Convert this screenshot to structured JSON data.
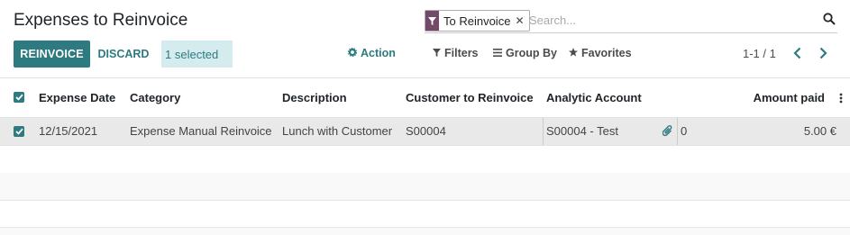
{
  "page": {
    "title": "Expenses to Reinvoice"
  },
  "search": {
    "facet_label": "To Reinvoice",
    "facet_icon": "filter-icon",
    "placeholder": "Search..."
  },
  "toolbar": {
    "reinvoice_label": "REINVOICE",
    "discard_label": "DISCARD",
    "selected_label": "1 selected",
    "action_label": "Action",
    "filters_label": "Filters",
    "groupby_label": "Group By",
    "favorites_label": "Favorites",
    "pager_label": "1-1 / 1"
  },
  "colors": {
    "primary": "#2d7b80",
    "brand": "#714b67",
    "selection": "#d5ecef"
  },
  "table": {
    "columns": {
      "expense_date": "Expense Date",
      "category": "Category",
      "description": "Description",
      "customer": "Customer to Reinvoice",
      "analytic": "Analytic Account",
      "amount": "Amount paid"
    },
    "rows": [
      {
        "expense_date": "12/15/2021",
        "category": "Expense Manual Reinvoice",
        "description": "Lunch with Customer",
        "customer": "S00004",
        "analytic": "S00004 - Test",
        "extra": "0",
        "amount": "5.00 €",
        "selected": true
      }
    ]
  }
}
